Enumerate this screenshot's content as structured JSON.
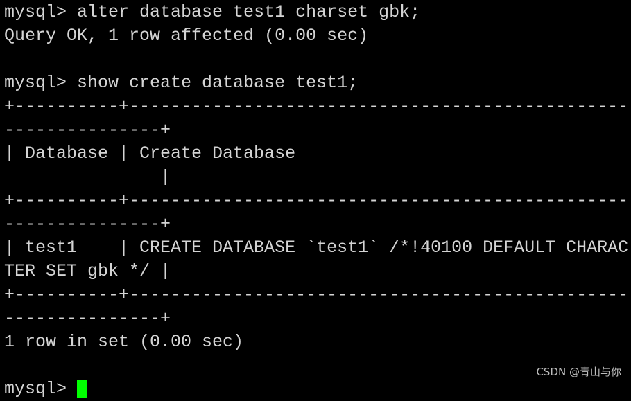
{
  "terminal": {
    "lines": [
      "mysql> alter database test1 charset gbk;",
      "Query OK, 1 row affected (0.00 sec)",
      "",
      "mysql> show create database test1;",
      "+----------+------------------------------------------------",
      "---------------+",
      "| Database | Create Database",
      "               |",
      "+----------+------------------------------------------------",
      "---------------+",
      "| test1    | CREATE DATABASE `test1` /*!40100 DEFAULT CHARAC",
      "TER SET gbk */ |",
      "+----------+------------------------------------------------",
      "---------------+",
      "1 row in set (0.00 sec)",
      ""
    ],
    "prompt": "mysql> ",
    "cursor_color": "#00ff00"
  },
  "watermark": "CSDN @青山与你"
}
